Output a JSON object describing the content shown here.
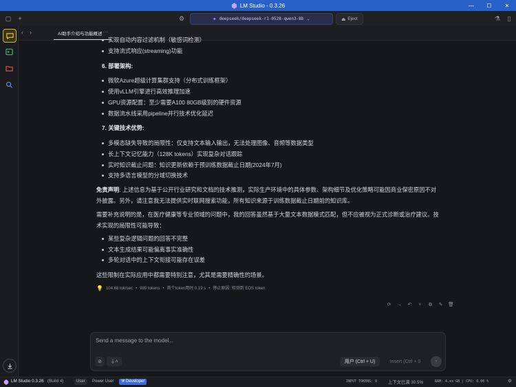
{
  "window": {
    "title": "LM Studio - 0.3.26",
    "colors": {
      "titlebar": "#2a61c9",
      "accent": "#d0b43a",
      "developer": "#3a6bd9"
    }
  },
  "topbar": {
    "model": "deepseek/deepseek-r1-0528-qwen3-8b",
    "eject_label": "Eject"
  },
  "tab": {
    "title": "AI助手介绍与功能概述",
    "menu": "···"
  },
  "chat": {
    "cut_line": "实现自动内容过滤机制（敏感词检测）",
    "items1": [
      "支持流式响应(streaming)功能"
    ],
    "h6_num": "6.",
    "h6": "部署架构:",
    "items6": [
      "微软Azure超级计算集群支持（分布式训练框架）",
      "使用vLLM引擎进行高效推理加速",
      "GPU资源配置：至少需要A100 80GB级别的硬件资源",
      "数据流水线采用pipeline并行技术优化延迟"
    ],
    "h7_num": "7.",
    "h7": "关键技术优势:",
    "items7": [
      "多模态缺失导致的局限性：仅支持文本输入输出，无法处理图像、音频等数据类型",
      "长上下文记忆能力（128K tokens）实现复杂对话跟踪",
      "实时知识截止问题：知识更新依赖于预训练数据截止日期(2024年7月)",
      "支持多语言模型的分域切换技术"
    ],
    "disclaimer_label": "免责声明",
    "disclaimer_text": ": 上述信息为基于公开行业研究和文档的技术推测，实际生产环境中的具体参数、架构细节及优化策略可能因商业保密原因不对外披露。另外，请注意我无法提供实时联网搜索功能，所有知识来源于训练数据截止日期前的知识库。",
    "para2": "需要补充说明的是，在医疗健康等专业领域的问题中，我的回答虽然基于大量文本数据模式匹配，但不应被视为正式诊断或治疗建议。技术实现的局限性可能导致：",
    "items_limits": [
      "某些复杂逻辑问题的回答不完整",
      "文本生成结果可能偏离事实准确性",
      "多轮对话中的上下文衔接可能存在误差"
    ],
    "final": "这些限制在实际应用中都需要特别注意，尤其是需要精确性的场景。",
    "stats": {
      "tps": "104.68 tok/sec",
      "tokens": "989 tokens",
      "ttft": "首个token用时 0.19 s",
      "stop": "停止原因: 检测到 EOS token",
      "sep": "•"
    }
  },
  "input": {
    "placeholder": "Send a message to the model...",
    "role_label": "用户 (Ctrl + U)",
    "insert_label": "Insert (Ctrl + 0"
  },
  "statusbar": {
    "app": "LM Studio 0.3.26",
    "build": "(Build 4)",
    "modes": [
      "User",
      "Power User",
      "Developer"
    ],
    "input_tokens": "INPUT TOKENS: 0",
    "context": "上下文已满 30.5%",
    "ram": "RAM: 4.xx GB | CPU: 0.00 %"
  }
}
